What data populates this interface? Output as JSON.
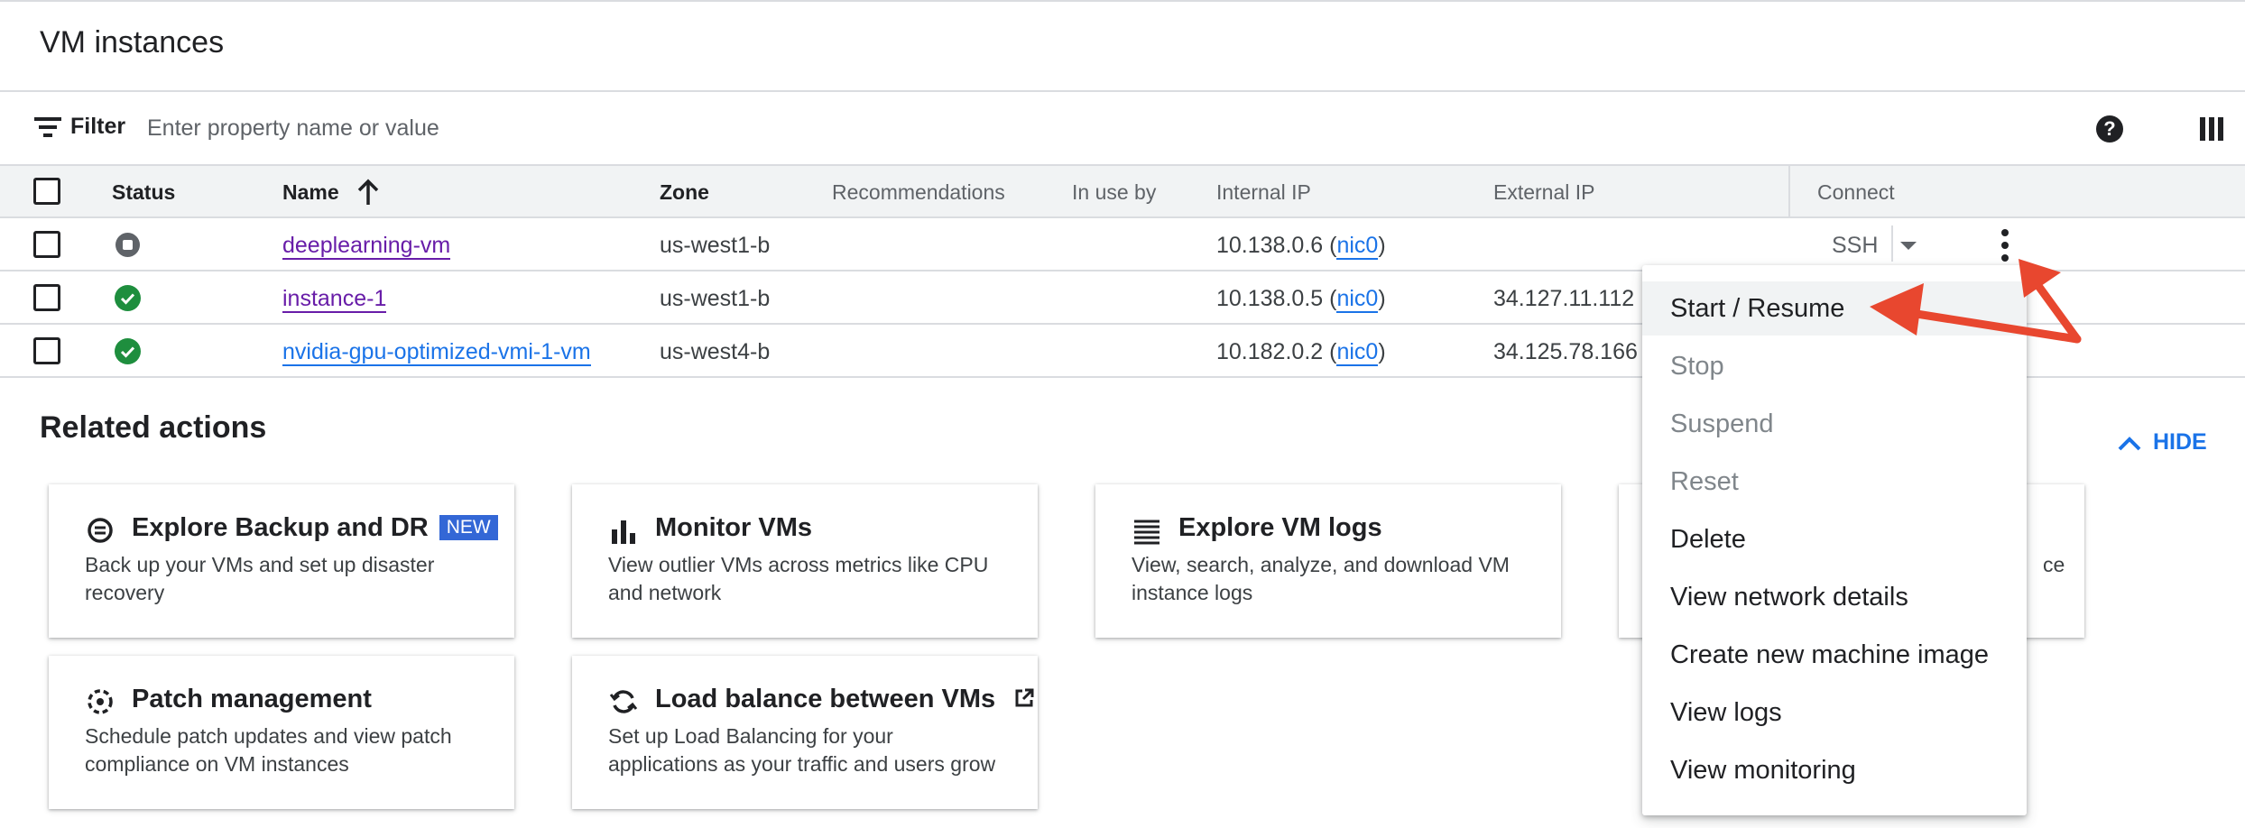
{
  "header": {
    "title": "VM instances"
  },
  "filter": {
    "label": "Filter",
    "placeholder": "Enter property name or value"
  },
  "toolbar": {
    "help_icon": "help-icon",
    "columns_icon": "column-display-icon"
  },
  "table": {
    "columns": [
      "Status",
      "Name",
      "Zone",
      "Recommendations",
      "In use by",
      "Internal IP",
      "External IP",
      "Connect"
    ],
    "sort": {
      "column": "Name",
      "direction": "ascending"
    },
    "rows": [
      {
        "status": "stopped",
        "name": "deeplearning-vm",
        "zone": "us-west1-b",
        "internal_ip": "10.138.0.6",
        "nic": "nic0",
        "external_ip": "",
        "connect": "SSH"
      },
      {
        "status": "running",
        "name": "instance-1",
        "zone": "us-west1-b",
        "internal_ip": "10.138.0.5",
        "nic": "nic0",
        "external_ip": "34.127.11.112",
        "connect": ""
      },
      {
        "status": "running",
        "name": "nvidia-gpu-optimized-vmi-1-vm",
        "zone": "us-west4-b",
        "internal_ip": "10.182.0.2",
        "nic": "nic0",
        "external_ip": "34.125.78.166",
        "connect": ""
      }
    ],
    "ip_paren_open": "(",
    "ip_paren_close": ")"
  },
  "related": {
    "title": "Related actions",
    "hide_label": "HIDE",
    "cards": [
      {
        "title": "Explore Backup and DR",
        "badge": "NEW",
        "desc": "Back up your VMs and set up disaster recovery",
        "icon": "backup-icon"
      },
      {
        "title": "Monitor VMs",
        "desc": "View outlier VMs across metrics like CPU and network",
        "icon": "bar-chart-icon"
      },
      {
        "title": "Explore VM logs",
        "desc": "View, search, analyze, and download VM instance logs",
        "icon": "logs-icon"
      },
      {
        "title": "",
        "desc": "ce",
        "icon": ""
      },
      {
        "title": "Patch management",
        "desc": "Schedule patch updates and view patch compliance on VM instances",
        "icon": "patch-icon"
      },
      {
        "title": "Load balance between VMs",
        "desc": "Set up Load Balancing for your applications as your traffic and users grow",
        "icon": "load-balance-icon"
      }
    ]
  },
  "menu": {
    "items": [
      {
        "label": "Start / Resume",
        "disabled": false
      },
      {
        "label": "Stop",
        "disabled": true
      },
      {
        "label": "Suspend",
        "disabled": true
      },
      {
        "label": "Reset",
        "disabled": true
      },
      {
        "label": "Delete",
        "disabled": false
      },
      {
        "label": "View network details",
        "disabled": false
      },
      {
        "label": "Create new machine image",
        "disabled": false
      },
      {
        "label": "View logs",
        "disabled": false
      },
      {
        "label": "View monitoring",
        "disabled": false
      }
    ]
  },
  "colors": {
    "link_visited": "#681da8",
    "link": "#1a73e8",
    "ok": "#1e8e3e",
    "annotation": "#e8472f"
  }
}
